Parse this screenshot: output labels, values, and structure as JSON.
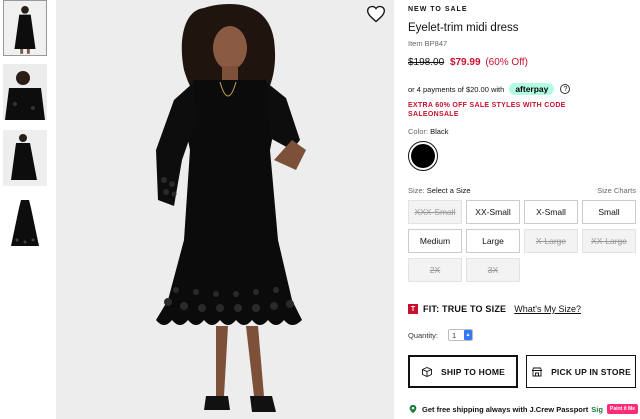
{
  "product": {
    "badge": "NEW TO SALE",
    "title": "Eyelet-trim midi dress",
    "item_number": "Item BP847",
    "original_price": "$198.00",
    "sale_price": "$79.99",
    "discount": "(60% Off)",
    "afterpay_text": "or 4 payments of $20.00 with",
    "afterpay_logo": "afterpay",
    "afterpay_info": "?",
    "promo": "EXTRA 60% OFF SALE STYLES WITH CODE SALEONSALE"
  },
  "color": {
    "label": "Color:",
    "selected": "Black",
    "swatch_hex": "#000000"
  },
  "size": {
    "label": "Size:",
    "prompt": "Select a Size",
    "charts_link": "Size Charts",
    "options": [
      {
        "label": "XXX-Small",
        "available": false
      },
      {
        "label": "XX-Small",
        "available": true
      },
      {
        "label": "X-Small",
        "available": true
      },
      {
        "label": "Small",
        "available": true
      },
      {
        "label": "Medium",
        "available": true
      },
      {
        "label": "Large",
        "available": true
      },
      {
        "label": "X-Large",
        "available": false
      },
      {
        "label": "XX-Large",
        "available": false
      },
      {
        "label": "2X",
        "available": false
      },
      {
        "label": "3X",
        "available": false
      }
    ]
  },
  "fit": {
    "badge": "T",
    "text": "FIT: TRUE TO SIZE",
    "link": "What's My Size?"
  },
  "quantity": {
    "label": "Quantity:",
    "value": "1"
  },
  "actions": {
    "ship": "SHIP TO HOME",
    "pickup": "PICK UP IN STORE"
  },
  "shipping": {
    "text": "Get free shipping always with J.Crew Passport",
    "link": "Sig"
  },
  "paint_badge": "Paint it Me",
  "colors": {
    "sale_red": "#c8102e",
    "afterpay_mint": "#b2fce4",
    "background_image": "#eeeeee"
  }
}
